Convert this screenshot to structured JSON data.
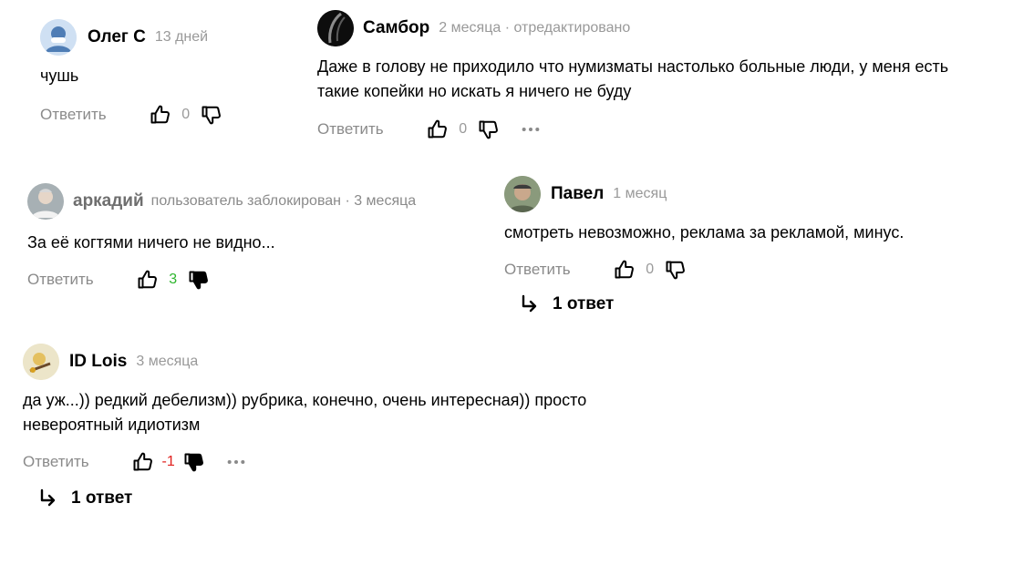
{
  "reply_label": "Ответить",
  "comments": [
    {
      "author": "Олег С",
      "meta": "13 дней",
      "text": "чушь",
      "score": "0"
    },
    {
      "author": "Самбор",
      "meta": "2 месяца · отредактировано",
      "text": "Даже в голову не приходило что нумизматы настолько больные люди, у меня есть такие копейки но искать я ничего не буду",
      "score": "0"
    },
    {
      "author": "аркадий",
      "meta": "пользователь заблокирован · 3 месяца",
      "text": "За её когтями ничего не видно...",
      "score": "3"
    },
    {
      "author": "Павел",
      "meta": "1 месяц",
      "text": "смотреть невозможно, реклама за рекламой, минус.",
      "score": "0",
      "replies": "1 ответ"
    },
    {
      "author": "ID Lois",
      "meta": "3 месяца",
      "text": "да уж...)) редкий дебелизм)) рубрика, конечно, очень интересная)) просто невероятный идиотизм",
      "score": "-1",
      "replies": "1 ответ"
    }
  ],
  "icons": {
    "like": "thumbs-up-icon",
    "dislike": "thumbs-down-icon",
    "more": "more-horizontal-icon",
    "reply_arrow": "reply-arrow-icon"
  },
  "colors": {
    "positive": "#2db52d",
    "negative": "#e0201e",
    "muted": "#8a8a8a"
  }
}
